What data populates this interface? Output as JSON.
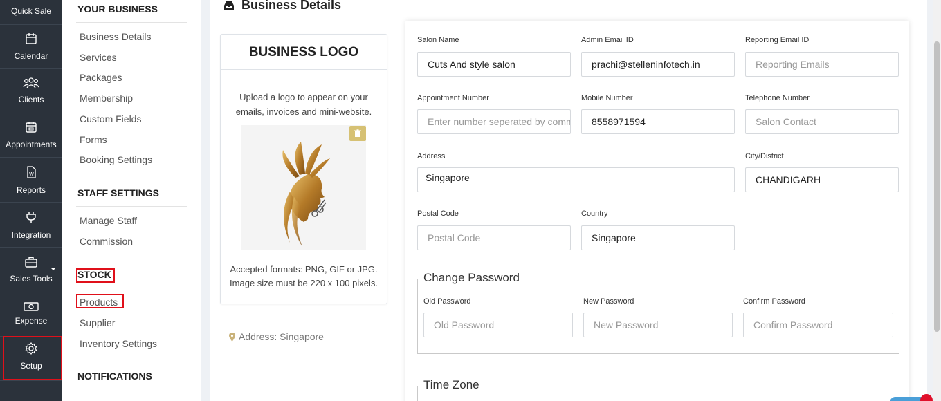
{
  "nav": {
    "quick_sale": "Quick Sale",
    "calendar": "Calendar",
    "clients": "Clients",
    "appointments": "Appointments",
    "reports": "Reports",
    "integration": "Integration",
    "sales_tools": "Sales Tools",
    "expense": "Expense",
    "setup": "Setup"
  },
  "menu": {
    "your_business": "YOUR BUSINESS",
    "business_items": [
      "Business Details",
      "Services",
      "Packages",
      "Membership",
      "Custom Fields",
      "Forms",
      "Booking Settings"
    ],
    "staff_settings": "STAFF SETTINGS",
    "staff_items": [
      "Manage Staff",
      "Commission"
    ],
    "stock": "STOCK",
    "stock_items": [
      "Products",
      "Supplier",
      "Inventory Settings"
    ],
    "notifications": "NOTIFICATIONS"
  },
  "page": {
    "title": "Business Details"
  },
  "logo_card": {
    "title": "BUSINESS LOGO",
    "description": "Upload a logo to appear on your emails, invoices and mini-website.",
    "formats": "Accepted formats: PNG, GIF or JPG. Image size must be 220 x 100 pixels.",
    "address": "Address: Singapore"
  },
  "form": {
    "salon_name": {
      "label": "Salon Name",
      "value": "Cuts And style salon"
    },
    "admin_email": {
      "label": "Admin Email ID",
      "value": "prachi@stelleninfotech.in"
    },
    "reporting_email": {
      "label": "Reporting Email ID",
      "placeholder": "Reporting Emails"
    },
    "appointment_number": {
      "label": "Appointment Number",
      "placeholder": "Enter number seperated by comma"
    },
    "mobile_number": {
      "label": "Mobile Number",
      "value": "8558971594"
    },
    "telephone_number": {
      "label": "Telephone Number",
      "placeholder": "Salon Contact"
    },
    "address": {
      "label": "Address",
      "value": "Singapore"
    },
    "city": {
      "label": "City/District",
      "value": "CHANDIGARH"
    },
    "postal_code": {
      "label": "Postal Code",
      "placeholder": "Postal Code"
    },
    "country": {
      "label": "Country",
      "value": "Singapore"
    },
    "change_password": {
      "legend": "Change Password",
      "old": {
        "label": "Old Password",
        "placeholder": "Old Password"
      },
      "new": {
        "label": "New Password",
        "placeholder": "New Password"
      },
      "confirm": {
        "label": "Confirm Password",
        "placeholder": "Confirm Password"
      }
    },
    "time_zone": {
      "legend": "Time Zone"
    }
  },
  "colors": {
    "nav_bg": "#2b323b",
    "highlight": "#e0101a",
    "trash_button": "#d6c174"
  },
  "icons": {
    "calendar": "calendar-icon",
    "clients": "users-icon",
    "appointments": "calendar-check-icon",
    "reports": "document-icon",
    "integration": "plug-icon",
    "sales_tools": "briefcase-icon",
    "expense": "money-icon",
    "setup": "gear-icon"
  }
}
